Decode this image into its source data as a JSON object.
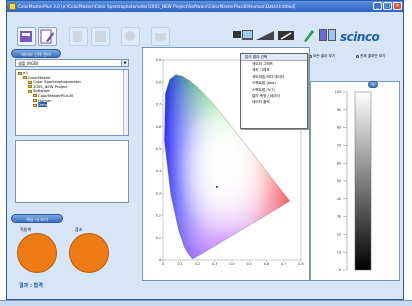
{
  "window": {
    "title": "ColorMasterPlus 3.0 [e:\\ColorMaster\\Color Spectrophotometer\\2005_NEW Project\\Software\\ColorMasterPlus30\\Human\\Data\\Untitled]",
    "min_label": "_",
    "max_label": "□",
    "close_label": "×"
  },
  "toolbar": {
    "buttons": [
      {
        "name": "new-measure-icon",
        "enabled": true
      },
      {
        "name": "edit-icon",
        "enabled": true
      },
      {
        "name": "copy-icon",
        "enabled": false
      },
      {
        "name": "export-icon",
        "enabled": false
      },
      {
        "name": "color-tool-icon",
        "enabled": false
      },
      {
        "name": "print-icon",
        "enabled": false
      }
    ],
    "right_buttons": [
      {
        "name": "display-icon"
      },
      {
        "name": "measure-icon"
      },
      {
        "name": "instrument-icon"
      },
      {
        "name": "calibrate-icon"
      }
    ],
    "logo": "scinco"
  },
  "left": {
    "data_select_label": "데이터 선택 관리",
    "combo_value": "샘플 (RGB)",
    "tree": [
      {
        "label": "e:\\",
        "depth": 0
      },
      {
        "label": "ColorMaster",
        "depth": 1
      },
      {
        "label": "Color Spectrophotometer",
        "depth": 2
      },
      {
        "label": "2005_NEW Project",
        "depth": 2
      },
      {
        "label": "Software",
        "depth": 2
      },
      {
        "label": "ColorMasterPlus30",
        "depth": 3
      },
      {
        "label": "Human",
        "depth": 3
      },
      {
        "label": "Data",
        "depth": 3,
        "selected": true
      }
    ],
    "compare_label": "색상 비 보기",
    "col1": "적용색",
    "col2": "참조",
    "result": "결과 : 합격",
    "swatch_color": "#ee7b14"
  },
  "chart_header": {
    "title_label": "분석 측정 결과",
    "menu_head": "분석 결과 선택",
    "menu_items": [
      "색도좌 그래프",
      "색차 그래프",
      "색도좌표/색차 데이터",
      "스펙트럼 (Abs)",
      "스펙트럼 (%T)",
      "컬러 측정 / 데이터",
      "데이터 출력"
    ],
    "radio1": "모든 결과 보기",
    "radio2": "전체 결과만 보기"
  },
  "chart_data": {
    "type": "scatter",
    "title": "",
    "xlabel": "",
    "ylabel": "",
    "xlim": [
      0,
      0.8
    ],
    "ylim": [
      0,
      0.9
    ],
    "x_ticks": [
      "0",
      "0.1",
      "0.2",
      "0.3",
      "0.4",
      "0.5",
      "0.6",
      "0.7",
      "0.8"
    ],
    "y_ticks": [
      "0",
      "0.1",
      "0.2",
      "0.3",
      "0.4",
      "0.5",
      "0.6",
      "0.7",
      "0.8",
      "0.9"
    ],
    "locus": [
      [
        0.175,
        0.005
      ],
      [
        0.172,
        0.005
      ],
      [
        0.166,
        0.009
      ],
      [
        0.144,
        0.03
      ],
      [
        0.124,
        0.058
      ],
      [
        0.091,
        0.133
      ],
      [
        0.045,
        0.295
      ],
      [
        0.008,
        0.538
      ],
      [
        0.014,
        0.75
      ],
      [
        0.039,
        0.812
      ],
      [
        0.074,
        0.834
      ],
      [
        0.115,
        0.826
      ],
      [
        0.155,
        0.806
      ],
      [
        0.193,
        0.782
      ],
      [
        0.23,
        0.754
      ],
      [
        0.266,
        0.724
      ],
      [
        0.302,
        0.692
      ],
      [
        0.337,
        0.659
      ],
      [
        0.373,
        0.624
      ],
      [
        0.408,
        0.589
      ],
      [
        0.444,
        0.554
      ],
      [
        0.479,
        0.52
      ],
      [
        0.512,
        0.487
      ],
      [
        0.547,
        0.452
      ],
      [
        0.575,
        0.424
      ],
      [
        0.603,
        0.396
      ],
      [
        0.627,
        0.372
      ],
      [
        0.648,
        0.351
      ],
      [
        0.665,
        0.334
      ],
      [
        0.68,
        0.32
      ],
      [
        0.691,
        0.308
      ],
      [
        0.705,
        0.295
      ],
      [
        0.735,
        0.265
      ]
    ],
    "series": [
      {
        "x": [
          0.312
        ],
        "y": [
          0.329
        ]
      }
    ]
  },
  "right": {
    "badge": "H",
    "scale_ticks": [
      "100",
      "90",
      "80",
      "70",
      "60",
      "50",
      "40",
      "30",
      "20",
      "10",
      "0"
    ]
  }
}
